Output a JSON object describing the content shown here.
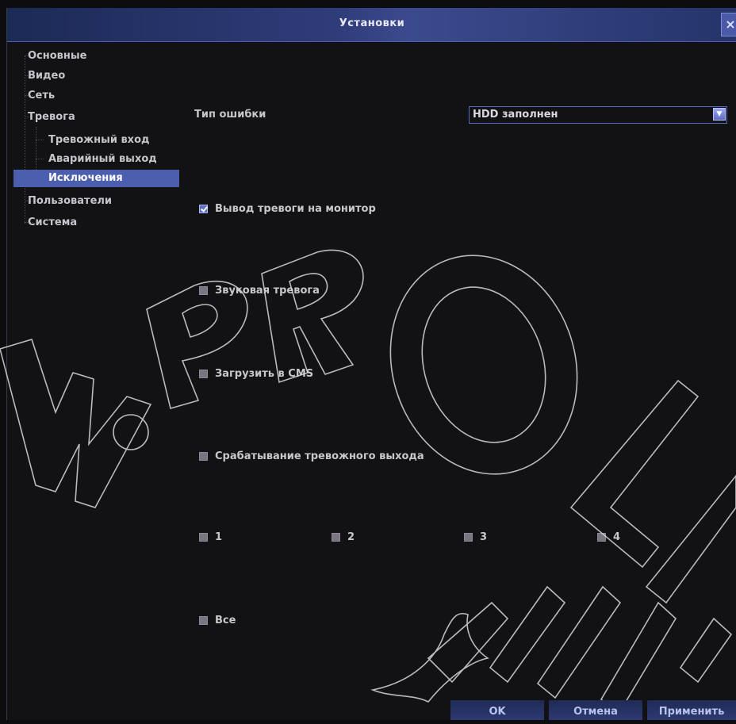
{
  "window": {
    "title": "Установки",
    "close_glyph": "×"
  },
  "sidebar": {
    "items": [
      {
        "label": "Основные"
      },
      {
        "label": "Видео"
      },
      {
        "label": "Сеть"
      },
      {
        "label": "Тревога"
      },
      {
        "label": "Тревожный вход"
      },
      {
        "label": "Аварийный выход"
      },
      {
        "label": "Исключения",
        "selected": true
      },
      {
        "label": "Пользователи"
      },
      {
        "label": "Система"
      }
    ]
  },
  "main": {
    "error_type_label": "Тип ошибки",
    "error_type_value": "HDD заполнен",
    "show_on_monitor": {
      "label": "Вывод тревоги на монитор",
      "checked": true
    },
    "audible_alarm": {
      "label": "Звуковая тревога",
      "checked": false
    },
    "upload_cms": {
      "label": "Загрузить в CMS",
      "checked": false
    },
    "trigger_alarm_output": {
      "label": "Срабатывание тревожного выхода",
      "checked": false
    },
    "outputs": [
      {
        "label": "1",
        "checked": false
      },
      {
        "label": "2",
        "checked": false
      },
      {
        "label": "3",
        "checked": false
      },
      {
        "label": "4",
        "checked": false
      }
    ],
    "all": {
      "label": "Все",
      "checked": false
    }
  },
  "footer": {
    "ok_label": "OK",
    "cancel_label": "Отмена",
    "apply_label": "Применить"
  },
  "watermark_text": "W.PROLINE",
  "colors": {
    "accent": "#4c5fae",
    "titlebar": "#2f3c7a",
    "background": "#121214"
  }
}
